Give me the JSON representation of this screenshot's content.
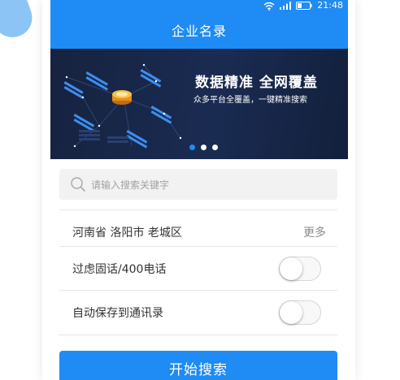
{
  "colors": {
    "accent": "#1f8bf4",
    "banner_bg": "#16233f",
    "decor_blob": "#8cc4f6",
    "field_bg": "#f2f2f2"
  },
  "status_bar": {
    "time": "21:48",
    "icons": [
      "wifi-icon",
      "signal-icon",
      "battery-icon"
    ]
  },
  "header": {
    "title": "企业名录"
  },
  "banner": {
    "headline": "数据精准 全网覆盖",
    "subline": "众多平台全覆盖，一键精准搜索",
    "active_slide": 1,
    "slide_count": 3
  },
  "search": {
    "placeholder": "请输入搜索关键字",
    "icon": "search-icon"
  },
  "region_row": {
    "label": "河南省 洛阳市 老城区",
    "action": "更多"
  },
  "toggles": [
    {
      "label": "过虑固话/400电话",
      "on": false
    },
    {
      "label": "自动保存到通讯录",
      "on": false
    }
  ],
  "start_button": {
    "label": "开始搜索"
  }
}
